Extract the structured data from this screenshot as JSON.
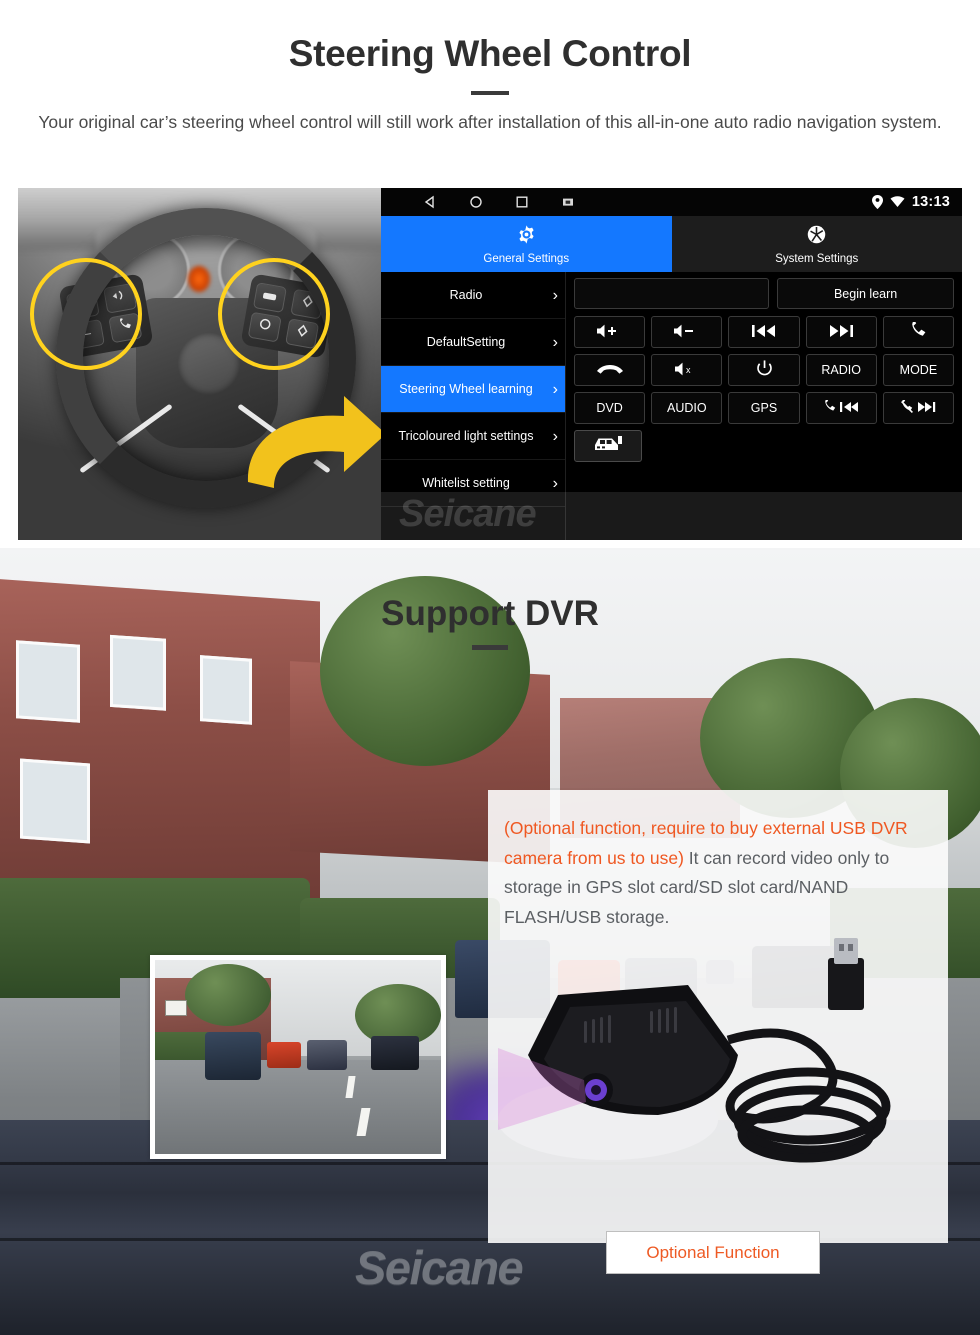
{
  "section_swc": {
    "title": "Steering Wheel Control",
    "subtitle": "Your original car’s steering wheel control will still work after installation of this all-in-one auto radio navigation system.",
    "head_unit": {
      "statusbar": {
        "back_icon": "back-triangle-icon",
        "home_icon": "home-circle-icon",
        "recents_icon": "recents-square-icon",
        "screenshot_icon": "screenshot-icon",
        "location_icon": "location-pin-icon",
        "wifi_icon": "wifi-icon",
        "time": "13:13"
      },
      "tabs": [
        {
          "label": "General Settings",
          "icon": "gear-icon",
          "active": true
        },
        {
          "label": "System Settings",
          "icon": "system-settings-icon",
          "active": false
        }
      ],
      "menu": [
        {
          "label": "Radio",
          "selected": false
        },
        {
          "label": "DefaultSetting",
          "selected": false
        },
        {
          "label": "Steering Wheel learning",
          "selected": true
        },
        {
          "label": "Tricoloured light settings",
          "selected": false
        },
        {
          "label": "Whitelist setting",
          "selected": false
        }
      ],
      "learn_input_value": "",
      "learn_button": "Begin learn",
      "buttons": [
        [
          {
            "label": "",
            "icon": "volume-up-icon"
          },
          {
            "label": "",
            "icon": "volume-down-icon"
          },
          {
            "label": "",
            "icon": "previous-track-icon"
          },
          {
            "label": "",
            "icon": "next-track-icon"
          },
          {
            "label": "",
            "icon": "phone-answer-icon"
          }
        ],
        [
          {
            "label": "",
            "icon": "phone-hangup-icon"
          },
          {
            "label": "",
            "icon": "volume-mute-icon"
          },
          {
            "label": "",
            "icon": "power-icon"
          },
          {
            "label": "RADIO",
            "icon": ""
          },
          {
            "label": "MODE",
            "icon": ""
          }
        ],
        [
          {
            "label": "DVD",
            "icon": ""
          },
          {
            "label": "AUDIO",
            "icon": ""
          },
          {
            "label": "GPS",
            "icon": ""
          },
          {
            "label": "",
            "icon": "phone-previous-icon"
          },
          {
            "label": "",
            "icon": "phone-mute-next-icon"
          }
        ]
      ],
      "car_button_icon": "car-icon",
      "watermark": "Seicane"
    },
    "wheel_photo": {
      "left_keys": [
        "+",
        "−",
        "mode-icon",
        "phone-icon"
      ],
      "right_keys": [
        "media-icon",
        "up-icon",
        "circle-icon",
        "down-icon"
      ],
      "highlight_color": "#ffd21e",
      "arrow_color": "#f2c21c"
    }
  },
  "section_dvr": {
    "title": "Support DVR",
    "note_highlight": "(Optional function, require to buy external USB DVR camera from us to use)",
    "note_body": "It can record video only to storage in GPS slot card/SD slot card/NAND FLASH/USB storage.",
    "optional_button": "Optional Function",
    "watermark": "Seicane",
    "highlight_color": "#ef5822",
    "button_text_color": "#ee5a24"
  }
}
